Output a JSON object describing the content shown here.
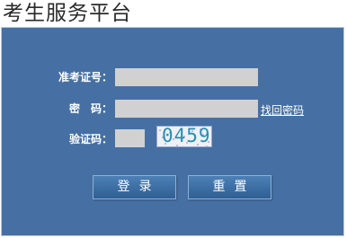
{
  "header": {
    "title": "考生服务平台"
  },
  "form": {
    "exam_id_label": "准考证号：",
    "exam_id_value": "",
    "password_label": "密　码：",
    "password_value": "",
    "forgot_password_link": "找回密码",
    "captcha_label": "验证码：",
    "captcha_value": "",
    "captcha_image_text": "0459"
  },
  "buttons": {
    "login": "登录",
    "reset": "重置"
  },
  "colors": {
    "panel_bg": "#4670a3",
    "input_bg": "#d1d1d1",
    "button_bg": "#3b6da3"
  }
}
